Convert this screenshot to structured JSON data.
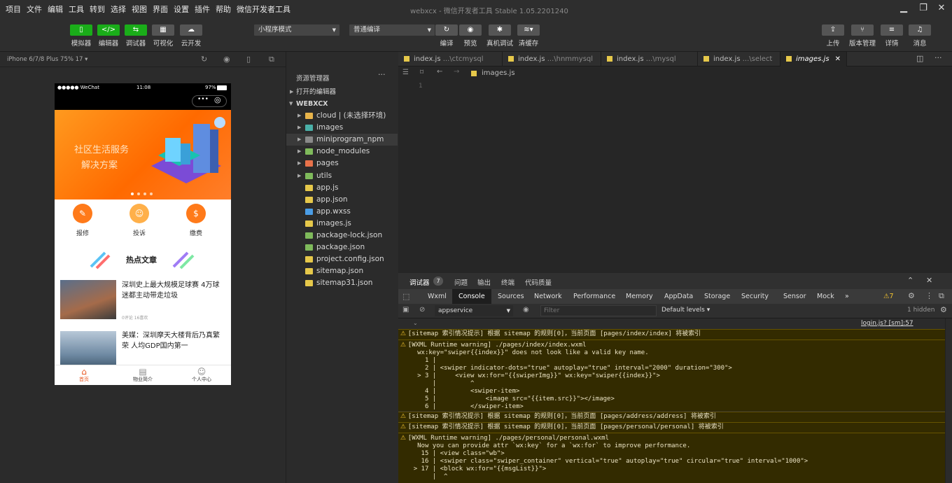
{
  "menu": [
    "项目",
    "文件",
    "编辑",
    "工具",
    "转到",
    "选择",
    "视图",
    "界面",
    "设置",
    "插件",
    "帮助",
    "微信开发者工具"
  ],
  "window_title": "webxcx - 微信开发者工具 Stable 1.05.2201240",
  "toolbar": {
    "simulator": "模拟器",
    "editor": "编辑器",
    "debugger": "调试器",
    "visual": "可视化",
    "cloud": "云开发",
    "mode_select": "小程序模式",
    "compile_select": "普通编译",
    "compile": "编译",
    "preview": "预览",
    "real_debug": "真机调试",
    "clear_cache": "清缓存",
    "upload": "上传",
    "version": "版本管理",
    "details": "详情",
    "messages": "消息"
  },
  "sim": {
    "device": "iPhone 6/7/8 Plus 75% 17 ▾",
    "status_left": "●●●●● WeChat",
    "status_time": "11:08",
    "status_right": "97%",
    "banner_text_1": "社区生活服务",
    "banner_text_2": "解决方案",
    "icons": [
      "报修",
      "投诉",
      "缴费"
    ],
    "hot_title": "热点文章",
    "articles": [
      {
        "title": "深圳史上最大规模足球赛 4万球迷都主动带走垃圾",
        "meta": "0评论   16喜欢"
      },
      {
        "title": "美媒：深圳摩天大楼背后乃真繁荣 人均GDP国内第一",
        "meta": ""
      }
    ],
    "tabs": [
      "首页",
      "物业简介",
      "个人中心"
    ]
  },
  "explorer": {
    "title": "资源管理器",
    "open_editors": "打开的编辑器",
    "project": "WEBXCX",
    "items": [
      {
        "name": "cloud | (未选择环境)",
        "type": "folder"
      },
      {
        "name": "images",
        "type": "folder"
      },
      {
        "name": "miniprogram_npm",
        "type": "folder"
      },
      {
        "name": "node_modules",
        "type": "folder"
      },
      {
        "name": "pages",
        "type": "folder"
      },
      {
        "name": "utils",
        "type": "folder"
      },
      {
        "name": "app.js",
        "type": "js"
      },
      {
        "name": "app.json",
        "type": "json"
      },
      {
        "name": "app.wxss",
        "type": "wxss"
      },
      {
        "name": "images.js",
        "type": "js"
      },
      {
        "name": "package-lock.json",
        "type": "pkg"
      },
      {
        "name": "package.json",
        "type": "pkg"
      },
      {
        "name": "project.config.json",
        "type": "json"
      },
      {
        "name": "sitemap.json",
        "type": "json"
      },
      {
        "name": "sitemap31.json",
        "type": "json"
      }
    ]
  },
  "editor": {
    "tabs": [
      {
        "name": "index.js",
        "path": "...\\ctcmysql"
      },
      {
        "name": "index.js",
        "path": "...\\hnmmysql"
      },
      {
        "name": "index.js",
        "path": "...\\mysql"
      },
      {
        "name": "index.js",
        "path": "...\\select"
      },
      {
        "name": "images.js",
        "path": ""
      }
    ],
    "breadcrumb": "images.js",
    "line_no": "1"
  },
  "debug": {
    "tabs": [
      "调试器",
      "问题",
      "输出",
      "终端",
      "代码质量"
    ],
    "badge": "7",
    "devtabs": [
      "Wxml",
      "Console",
      "Sources",
      "Network",
      "Performance",
      "Memory",
      "AppData",
      "Storage",
      "Security",
      "Sensor",
      "Mock",
      "»"
    ],
    "warn_count": "⚠7",
    "context": "appservice",
    "filter_placeholder": "Filter",
    "levels": "Default levels ▾",
    "hidden": "1 hidden",
    "link": "login.js? [sm]:57",
    "lines": [
      "[sitemap 索引情况提示] 根据 sitemap 的规则[0]，当前页面 [pages/index/index] 将被索引",
      "[WXML Runtime warning] ./pages/index/index.wxml",
      " wx:key=\"swiper{{index}}\" does not look like a valid key name.",
      "   1 |",
      "   2 | <swiper indicator-dots=\"true\" autoplay=\"true\" interval=\"2000\" duration=\"300\">",
      " > 3 |     <view wx:for=\"{{swiperImg}}\" wx:key=\"swiper{{index}}\">",
      "     |         ^",
      "   4 |         <swiper-item>",
      "   5 |             <image src=\"{{item.src}}\"></image>",
      "   6 |         </swiper-item>",
      "[sitemap 索引情况提示] 根据 sitemap 的规则[0]，当前页面 [pages/address/address] 将被索引",
      "[sitemap 索引情况提示] 根据 sitemap 的规则[0]，当前页面 [pages/personal/personal] 将被索引",
      "[WXML Runtime warning] ./pages/personal/personal.wxml",
      " Now you can provide attr `wx:key` for a `wx:for` to improve performance.",
      "  15 | <view class=\"wb\">",
      "  16 | <swiper class=\"swiper_container\" vertical=\"true\" autoplay=\"true\" circular=\"true\" interval=\"1000\">",
      "> 17 | <block wx:for=\"{{msgList}}\">",
      "     |  ^"
    ]
  },
  "colors": {
    "accent_green": "#1aad19",
    "warn_bg": "#332b00",
    "warn_text": "#f2c22f",
    "banner_orange": "#ff6a00"
  }
}
